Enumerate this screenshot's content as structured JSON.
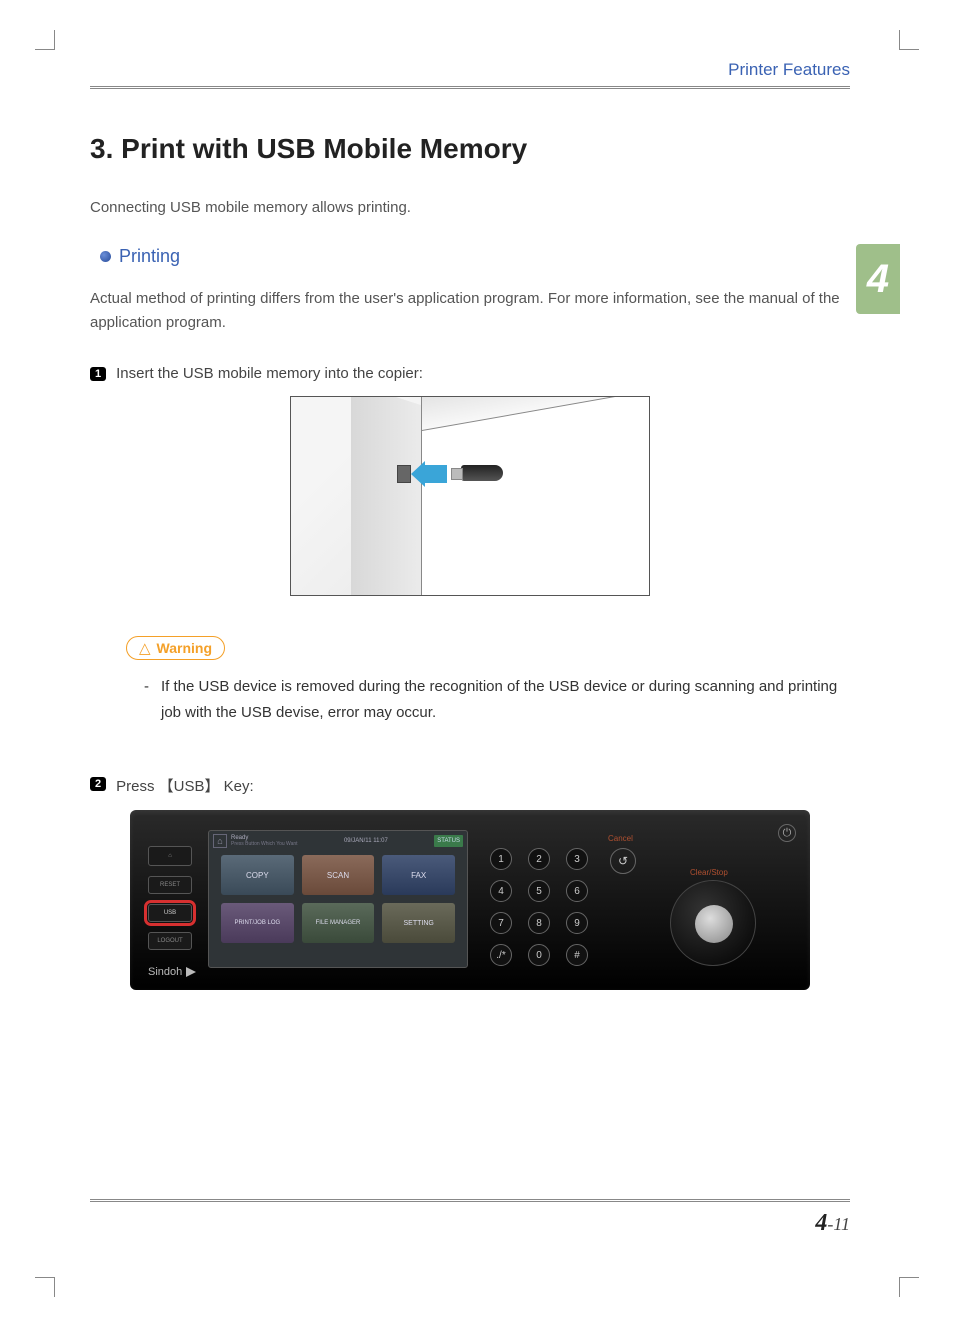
{
  "header": {
    "title": "Printer Features"
  },
  "chapter_tab": "4",
  "section": {
    "number": "3.",
    "title": "Print with USB Mobile Memory"
  },
  "intro": "Connecting USB mobile memory allows printing.",
  "subsection": {
    "title": "Printing"
  },
  "body": "Actual method of printing differs from the user's application program. For more information, see the manual of the application program.",
  "steps": [
    {
      "n": "1",
      "text": "Insert the USB mobile memory into the copier:"
    },
    {
      "n": "2",
      "text_pre": "Press ",
      "key": "【USB】",
      "text_post": " Key:"
    }
  ],
  "warning": {
    "label": "Warning",
    "items": [
      "If the USB device is removed during the recognition of the USB device or during scanning and printing job with the USB devise, error may occur."
    ]
  },
  "panel": {
    "brand": "Sindoh",
    "side_buttons": {
      "home": "⌂",
      "reset": "RESET",
      "usb": "USB",
      "logout": "LOGOUT"
    },
    "screen": {
      "top_hint": "Ready",
      "top_sub": "Press Button Which You Want",
      "datetime": "09/JAN/11 11:07",
      "status": "STATUS",
      "tiles": {
        "copy": "COPY",
        "scan": "SCAN",
        "fax": "FAX",
        "printjob": "PRINT/JOB LOG",
        "filemgr": "FILE MANAGER",
        "setting": "SETTING"
      }
    },
    "keypad": [
      "1",
      "2",
      "3",
      "4",
      "5",
      "6",
      "7",
      "8",
      "9",
      "./*",
      "0",
      "#"
    ],
    "cancel_label": "Cancel",
    "clear_label": "Clear/Stop",
    "cancel_glyph": "↺",
    "power_glyph": "⏻"
  },
  "footer": {
    "chapter": "4",
    "sep": "-",
    "page": "11"
  }
}
